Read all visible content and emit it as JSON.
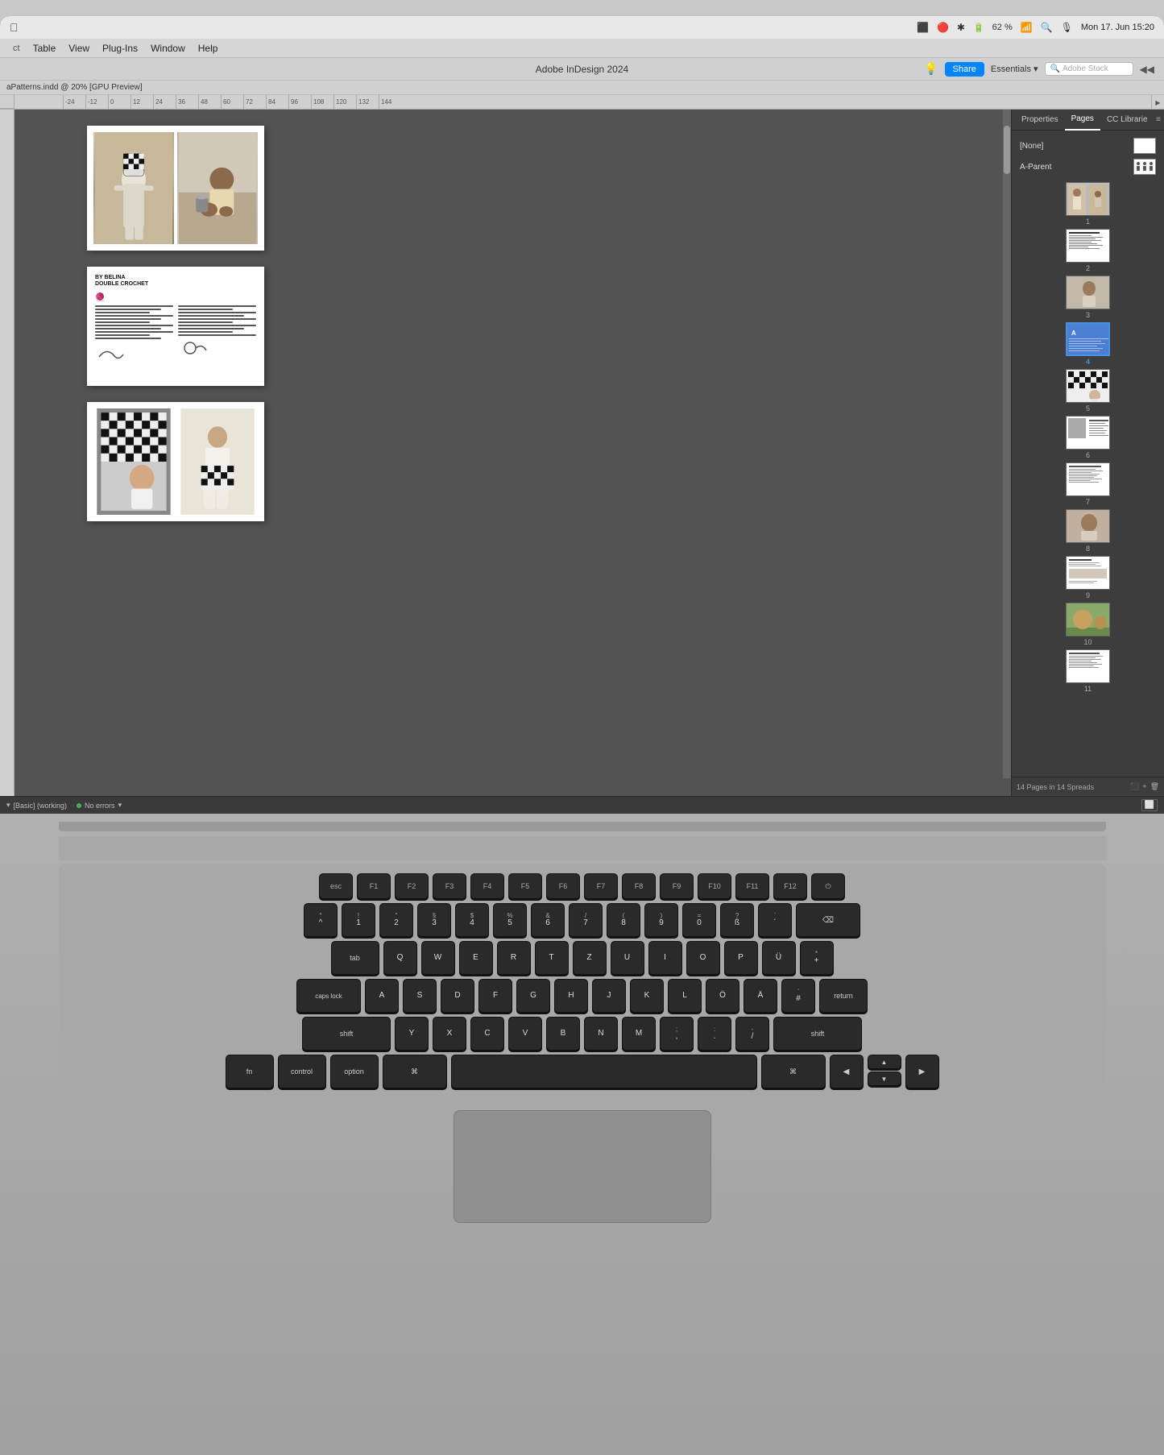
{
  "screen": {
    "title": "Adobe InDesign 2024",
    "doc_name": "aPatterns.indd @ 20% [GPU Preview]",
    "zoom": "62 %",
    "datetime": "Mon 17. Jun  15:20"
  },
  "macos": {
    "battery_label": "62 %",
    "datetime": "Mon 17. Jun  15:20",
    "wifi_label": "wifi",
    "search_placeholder": "Spotlight"
  },
  "menu": {
    "items": [
      "ct",
      "Table",
      "View",
      "Plug-Ins",
      "Window",
      "Help"
    ]
  },
  "toolbar": {
    "share_label": "Share",
    "essentials_label": "Essentials",
    "search_placeholder": "Adobe Stock",
    "share_icon": "☁",
    "light_icon": "💡"
  },
  "document": {
    "name": "aPatterns.indd @ 20% [GPU Preview]"
  },
  "ruler": {
    "marks": [
      "-24",
      "-12",
      "0",
      "12",
      "24",
      "36",
      "48",
      "60",
      "72",
      "84",
      "96",
      "108",
      "120",
      "132",
      "144"
    ]
  },
  "pages_panel": {
    "tab_properties": "Properties",
    "tab_pages": "Pages",
    "tab_cc": "CC Librarie",
    "none_label": "[None]",
    "a_parent_label": "A-Parent",
    "page_count_label": "14 Pages in 14 Spreads",
    "pages": [
      {
        "num": "1",
        "selected": false
      },
      {
        "num": "2",
        "selected": false
      },
      {
        "num": "3",
        "selected": false
      },
      {
        "num": "4",
        "selected": true
      },
      {
        "num": "5",
        "selected": false
      },
      {
        "num": "6",
        "selected": false
      },
      {
        "num": "7",
        "selected": false
      },
      {
        "num": "8",
        "selected": false
      },
      {
        "num": "9",
        "selected": false
      },
      {
        "num": "10",
        "selected": false
      },
      {
        "num": "11",
        "selected": false
      }
    ]
  },
  "status_bar": {
    "workspace_label": "[Basic] (working)",
    "errors_label": "No errors",
    "pages_label": ""
  },
  "page2": {
    "by_label": "BY BELINA",
    "title": "DOUBLE CROCHET"
  },
  "keyboard": {
    "fn_row": [
      "F1",
      "F2",
      "F3",
      "F4",
      "F5",
      "F6",
      "F7",
      "F8",
      "F9",
      "F10",
      "F11",
      "F12"
    ],
    "row1": [
      "!",
      "\"",
      "§",
      "$",
      "%",
      "&",
      "/",
      "(",
      ")",
      "=",
      "?",
      "`"
    ],
    "row1_sub": [
      "1",
      "2",
      "3",
      "4",
      "5",
      "6",
      "7",
      "8",
      "9",
      "0",
      "ß",
      "´"
    ],
    "row2": [
      "Q",
      "W",
      "E",
      "R",
      "T",
      "Z",
      "U",
      "I",
      "O",
      "P",
      "Ü",
      "+"
    ],
    "row3": [
      "A",
      "S",
      "D",
      "F",
      "G",
      "H",
      "J",
      "K",
      "L",
      "Ö",
      "Ä",
      "#"
    ],
    "row4": [
      "Y",
      "X",
      "C",
      "V",
      "B",
      "N",
      "M",
      ";",
      ":",
      "-"
    ]
  }
}
